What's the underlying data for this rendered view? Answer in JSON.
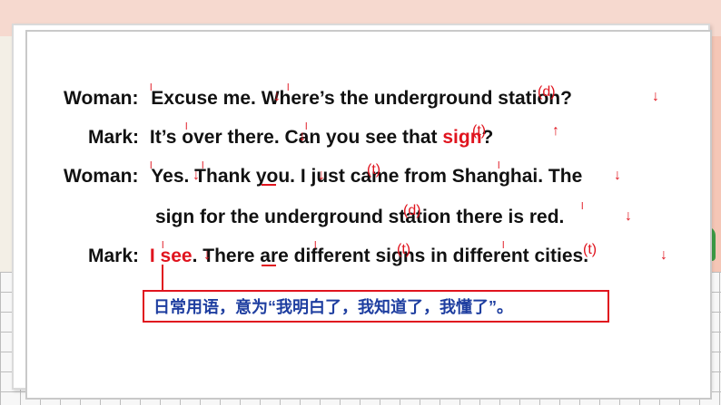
{
  "lines": [
    {
      "speaker": "Woman:",
      "text": "Excuse me. Where’s the underground station?"
    },
    {
      "speaker": "Mark:",
      "text": "It’s over there. Can you see that ",
      "highlight": "sign",
      "tail": "?"
    },
    {
      "speaker": "Woman:",
      "text": "Yes. Thank you. I just came from Shanghai. The"
    },
    {
      "speaker": "",
      "text": "sign for the underground station there is red."
    },
    {
      "speaker": "Mark:",
      "pre": "I ",
      "highlight": "see",
      "text": ". There are different signs in different cities."
    }
  ],
  "note": "日常用语，意为“我明白了，我知道了，我懂了”。",
  "marks": {
    "liaison_d": "(d)",
    "liaison_t": "(t)",
    "falling": "↓",
    "rising": "↑",
    "pause": "ˡ"
  },
  "colors": {
    "accent_red": "#e0141e",
    "note_text": "#1e3ea0"
  }
}
